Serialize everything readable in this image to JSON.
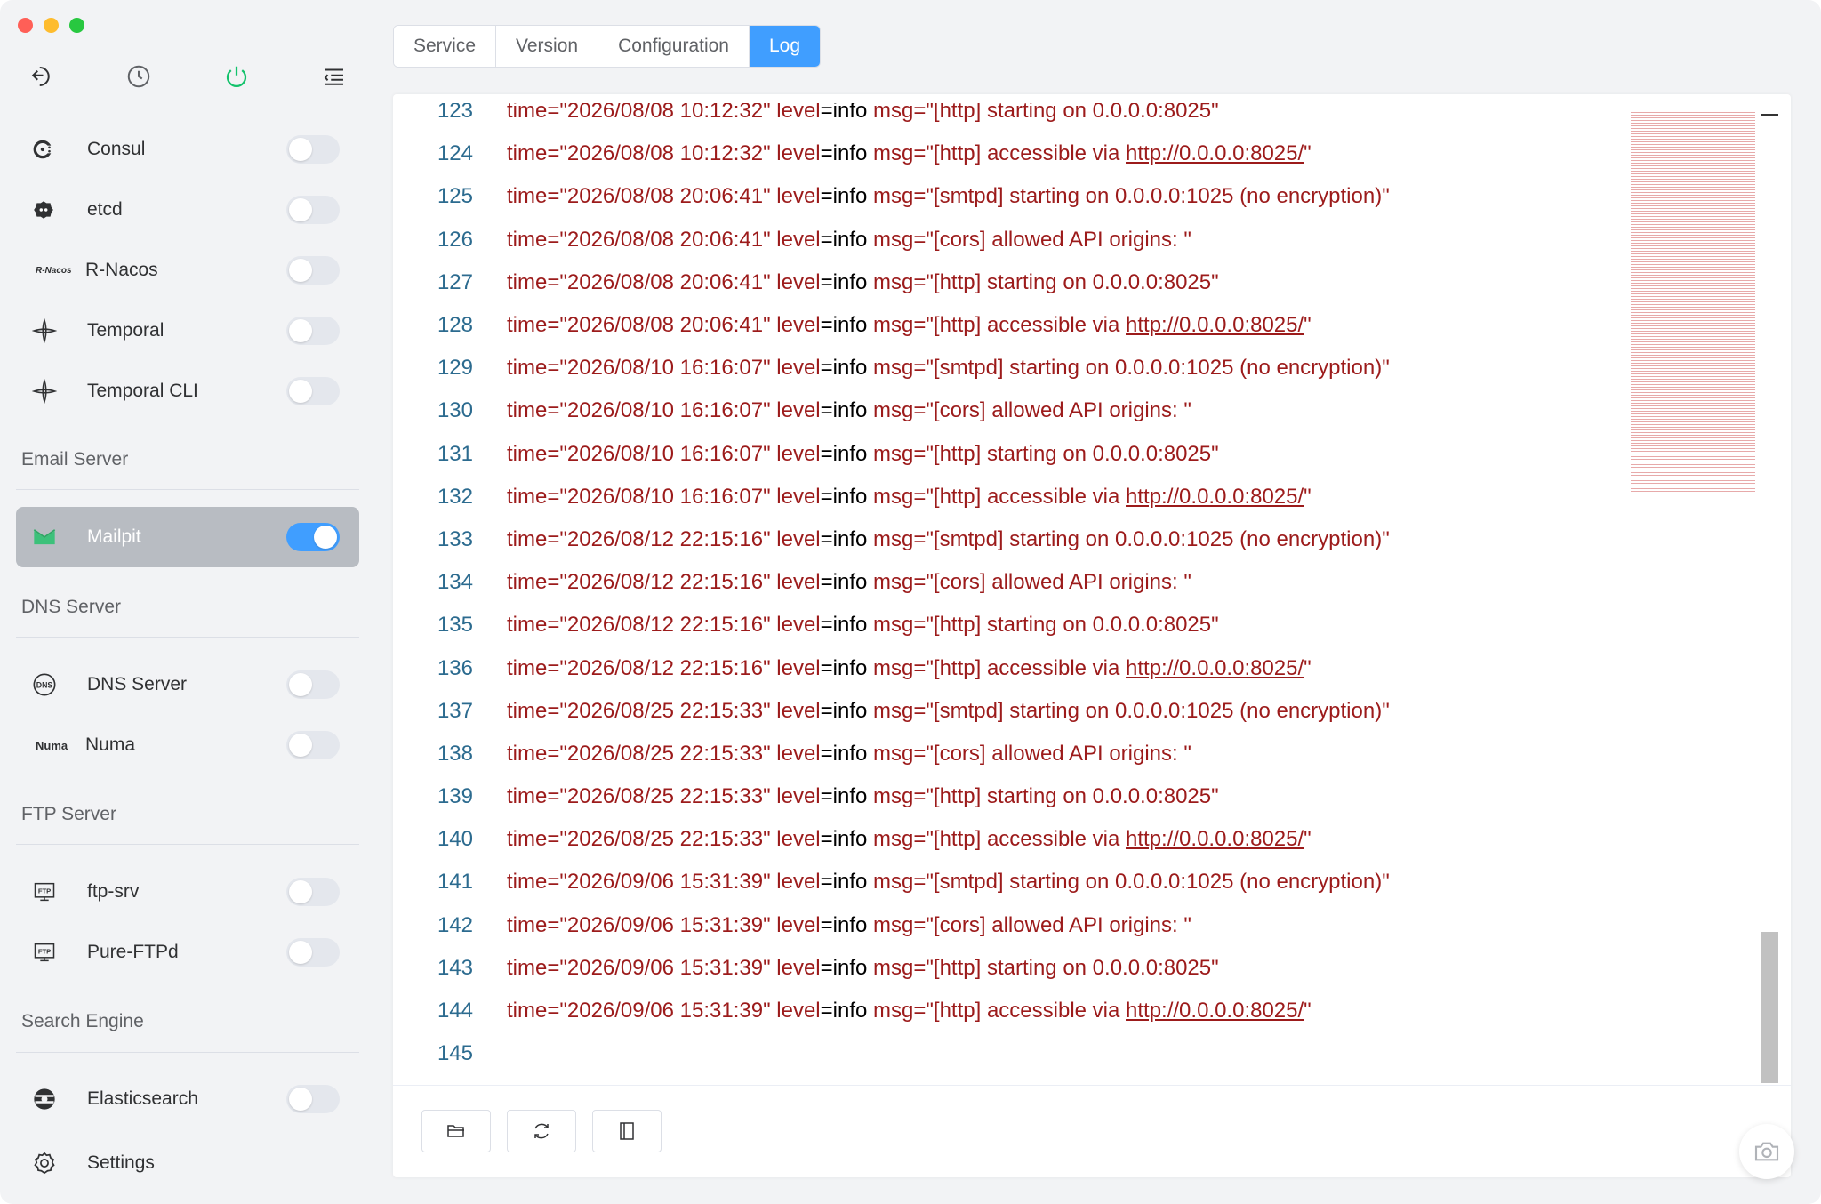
{
  "window": {
    "traffic_lights": [
      "close",
      "minimize",
      "zoom"
    ]
  },
  "toolbar": {
    "icons": [
      "exit-icon",
      "clock-icon",
      "power-icon",
      "collapse-menu-icon"
    ],
    "power_color": "#13c26b"
  },
  "sidebar": {
    "items_top": [
      {
        "icon": "consul-icon",
        "label": "Consul",
        "enabled": false
      },
      {
        "icon": "etcd-icon",
        "label": "etcd",
        "enabled": false
      },
      {
        "icon": "r-nacos-icon",
        "icon_text": "R-Nacos",
        "label": "R-Nacos",
        "enabled": false
      },
      {
        "icon": "temporal-icon",
        "label": "Temporal",
        "enabled": false
      },
      {
        "icon": "temporal-cli-icon",
        "label": "Temporal CLI",
        "enabled": false
      }
    ],
    "sections": [
      {
        "title": "Email Server",
        "items": [
          {
            "icon": "mailpit-icon",
            "label": "Mailpit",
            "enabled": true,
            "active": true
          }
        ]
      },
      {
        "title": "DNS Server",
        "items": [
          {
            "icon": "dns-icon",
            "icon_text": "DNS",
            "label": "DNS Server",
            "enabled": false
          },
          {
            "icon": "numa-icon",
            "icon_text": "Numa",
            "label": "Numa",
            "enabled": false
          }
        ]
      },
      {
        "title": "FTP Server",
        "items": [
          {
            "icon": "ftp-icon",
            "icon_text": "FTP",
            "label": "ftp-srv",
            "enabled": false
          },
          {
            "icon": "ftp-icon",
            "icon_text": "FTP",
            "label": "Pure-FTPd",
            "enabled": false
          }
        ]
      },
      {
        "title": "Search Engine",
        "items": [
          {
            "icon": "elasticsearch-icon",
            "label": "Elasticsearch",
            "enabled": false
          }
        ]
      }
    ],
    "settings_label": "Settings"
  },
  "tabs": [
    {
      "label": "Service",
      "active": false
    },
    {
      "label": "Version",
      "active": false
    },
    {
      "label": "Configuration",
      "active": false
    },
    {
      "label": "Log",
      "active": true
    }
  ],
  "log": {
    "lines": [
      {
        "n": "123",
        "time": "2026/08/08 10:12:32",
        "msg": "[http] starting on 0.0.0.0:8025"
      },
      {
        "n": "124",
        "time": "2026/08/08 10:12:32",
        "msg": "[http] accessible via ",
        "link": "http://0.0.0.0:8025/"
      },
      {
        "n": "125",
        "time": "2026/08/08 20:06:41",
        "msg": "[smtpd] starting on 0.0.0.0:1025 (no encryption)"
      },
      {
        "n": "126",
        "time": "2026/08/08 20:06:41",
        "msg": "[cors] allowed API origins: "
      },
      {
        "n": "127",
        "time": "2026/08/08 20:06:41",
        "msg": "[http] starting on 0.0.0.0:8025"
      },
      {
        "n": "128",
        "time": "2026/08/08 20:06:41",
        "msg": "[http] accessible via ",
        "link": "http://0.0.0.0:8025/"
      },
      {
        "n": "129",
        "time": "2026/08/10 16:16:07",
        "msg": "[smtpd] starting on 0.0.0.0:1025 (no encryption)"
      },
      {
        "n": "130",
        "time": "2026/08/10 16:16:07",
        "msg": "[cors] allowed API origins: "
      },
      {
        "n": "131",
        "time": "2026/08/10 16:16:07",
        "msg": "[http] starting on 0.0.0.0:8025"
      },
      {
        "n": "132",
        "time": "2026/08/10 16:16:07",
        "msg": "[http] accessible via ",
        "link": "http://0.0.0.0:8025/"
      },
      {
        "n": "133",
        "time": "2026/08/12 22:15:16",
        "msg": "[smtpd] starting on 0.0.0.0:1025 (no encryption)"
      },
      {
        "n": "134",
        "time": "2026/08/12 22:15:16",
        "msg": "[cors] allowed API origins: "
      },
      {
        "n": "135",
        "time": "2026/08/12 22:15:16",
        "msg": "[http] starting on 0.0.0.0:8025"
      },
      {
        "n": "136",
        "time": "2026/08/12 22:15:16",
        "msg": "[http] accessible via ",
        "link": "http://0.0.0.0:8025/"
      },
      {
        "n": "137",
        "time": "2026/08/25 22:15:33",
        "msg": "[smtpd] starting on 0.0.0.0:1025 (no encryption)"
      },
      {
        "n": "138",
        "time": "2026/08/25 22:15:33",
        "msg": "[cors] allowed API origins: "
      },
      {
        "n": "139",
        "time": "2026/08/25 22:15:33",
        "msg": "[http] starting on 0.0.0.0:8025"
      },
      {
        "n": "140",
        "time": "2026/08/25 22:15:33",
        "msg": "[http] accessible via ",
        "link": "http://0.0.0.0:8025/"
      },
      {
        "n": "141",
        "time": "2026/09/06 15:31:39",
        "msg": "[smtpd] starting on 0.0.0.0:1025 (no encryption)"
      },
      {
        "n": "142",
        "time": "2026/09/06 15:31:39",
        "msg": "[cors] allowed API origins: "
      },
      {
        "n": "143",
        "time": "2026/09/06 15:31:39",
        "msg": "[http] starting on 0.0.0.0:8025"
      },
      {
        "n": "144",
        "time": "2026/09/06 15:31:39",
        "msg": "[http] accessible via ",
        "link": "http://0.0.0.0:8025/"
      },
      {
        "n": "145",
        "time": "",
        "msg": ""
      }
    ]
  },
  "footer": {
    "buttons": [
      "open-folder-icon",
      "refresh-icon",
      "wrap-toggle-icon"
    ]
  },
  "colors": {
    "accent": "#409eff",
    "log_text": "#9c1b1b",
    "line_number": "#2c6b8f"
  }
}
